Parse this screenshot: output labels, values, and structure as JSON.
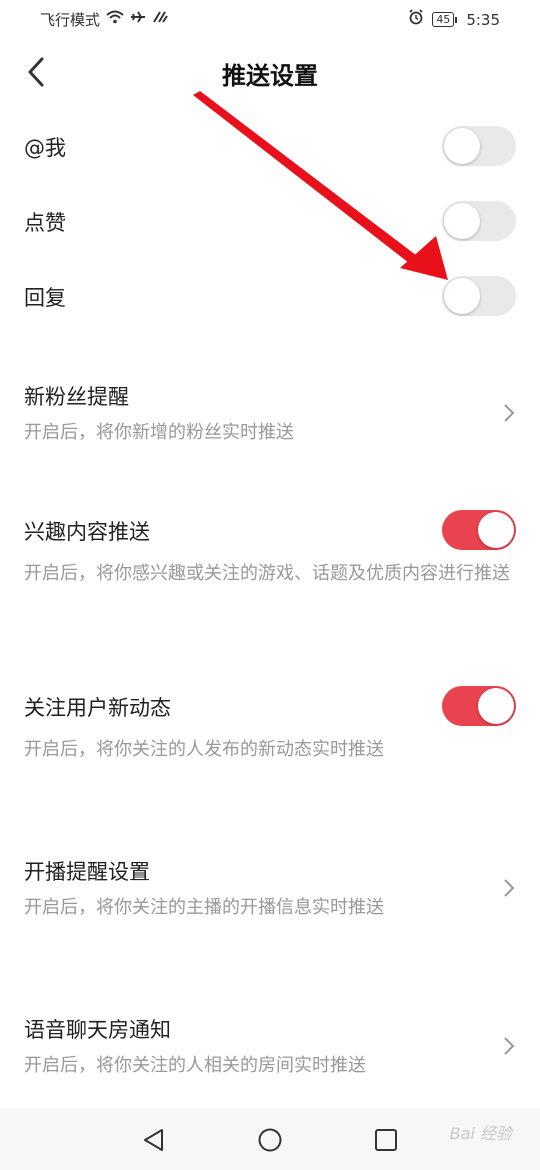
{
  "status_bar": {
    "left_text": "飞行模式",
    "battery": "45",
    "time": "5:35",
    "icons": [
      "wifi-icon",
      "airplane-icon",
      "hotspot-icon",
      "alarm-icon",
      "battery-icon"
    ]
  },
  "header": {
    "title": "推送设置",
    "back_icon": "chevron-left-icon"
  },
  "settings": [
    {
      "label": "@我",
      "control": "toggle",
      "on": false
    },
    {
      "label": "点赞",
      "control": "toggle",
      "on": false
    },
    {
      "label": "回复",
      "control": "toggle",
      "on": false
    },
    {
      "label": "新粉丝提醒",
      "desc": "开启后，将你新增的粉丝实时推送",
      "control": "chevron"
    },
    {
      "label": "兴趣内容推送",
      "desc": "开启后，将你感兴趣或关注的游戏、话题及优质内容进行推送",
      "control": "toggle",
      "on": true
    },
    {
      "label": "关注用户新动态",
      "desc": "开启后，将你关注的人发布的新动态实时推送",
      "control": "toggle",
      "on": true
    },
    {
      "label": "开播提醒设置",
      "desc": "开启后，将你关注的主播的开播信息实时推送",
      "control": "chevron"
    },
    {
      "label": "语音聊天房通知",
      "desc": "开启后，将你关注的人相关的房间实时推送",
      "control": "chevron"
    }
  ],
  "colors": {
    "accent": "#e8434f",
    "toggle_off": "#e9e9e9",
    "desc_text": "#999999",
    "annotation_arrow": "#e8101a"
  },
  "system_nav": [
    "back-triangle-icon",
    "home-circle-icon",
    "recents-square-icon"
  ],
  "watermark": "Bai 经验"
}
